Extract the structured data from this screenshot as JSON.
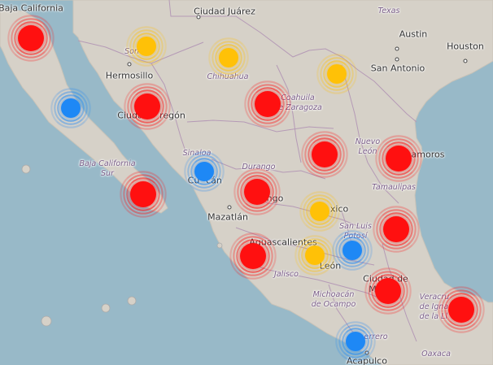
{
  "map": {
    "colors": {
      "water": "#98b9c8",
      "land": "#d6d1c8",
      "border": "#b59ab6",
      "red": "#ff1010",
      "orange": "#ffc107",
      "blue": "#1e88f5"
    },
    "city_labels": {
      "baja_california": "Baja California",
      "ciudad_juarez": "Ciudad Juárez",
      "texas": "Texas",
      "austin": "Austin",
      "houston": "Houston",
      "hermosillo": "Hermosillo",
      "san_antonio": "San Antonio",
      "chihuahua": "Chihuahua",
      "sonora_fragment": "Son",
      "ciudad_obregon_a": "Ciuda",
      "ciudad_obregon_b": "regón",
      "coahuila": "Coahuila\nde Zaragoza",
      "nuevo_leon": "Nuevo\nLeón",
      "matamoros_fragment": "amoros",
      "sinaloa": "Sinaloa",
      "culiacan_a": "Cu",
      "culiacan_b": "cán",
      "durango_state": "Durango",
      "durango_city": "ngo",
      "baja_california_sur": "Baja California\nSur",
      "tamaulipas": "Tamaulipas",
      "mexico_fragment": "xico",
      "mazatlan": "Mazatlán",
      "san_luis_potosi": "San Luis\nPotosí",
      "aguascalientes": "Aguascalientes",
      "leon_fragment": "León",
      "jalisco": "Jalisco",
      "ciudad_de_mexico_a": "Ciudad de",
      "ciudad_de_mexico_b": "M",
      "michoacan": "Michoacán\nde Ocampo",
      "veracruz": "Veracru\nde Igna\nde la Ll",
      "guerrero": "errero",
      "oaxaca": "Oaxaca",
      "acapulco": "Acapulco"
    },
    "markers": [
      {
        "id": "marker-tijuana",
        "status": "red"
      },
      {
        "id": "marker-sonora-north",
        "status": "orange"
      },
      {
        "id": "marker-chihuahua",
        "status": "orange"
      },
      {
        "id": "marker-san-antonio",
        "status": "orange"
      },
      {
        "id": "marker-baja-central",
        "status": "blue"
      },
      {
        "id": "marker-ciudad-obregon",
        "status": "red"
      },
      {
        "id": "marker-coahuila",
        "status": "red"
      },
      {
        "id": "marker-monterrey",
        "status": "red"
      },
      {
        "id": "marker-matamoros",
        "status": "red"
      },
      {
        "id": "marker-culiacan",
        "status": "blue"
      },
      {
        "id": "marker-la-paz",
        "status": "red"
      },
      {
        "id": "marker-durango",
        "status": "red"
      },
      {
        "id": "marker-zacatecas",
        "status": "orange"
      },
      {
        "id": "marker-tamaulipas-south",
        "status": "red"
      },
      {
        "id": "marker-guadalajara",
        "status": "red"
      },
      {
        "id": "marker-leon",
        "status": "orange"
      },
      {
        "id": "marker-san-luis-potosi",
        "status": "blue"
      },
      {
        "id": "marker-mexico-city",
        "status": "red"
      },
      {
        "id": "marker-veracruz",
        "status": "red"
      },
      {
        "id": "marker-acapulco",
        "status": "blue"
      }
    ]
  }
}
